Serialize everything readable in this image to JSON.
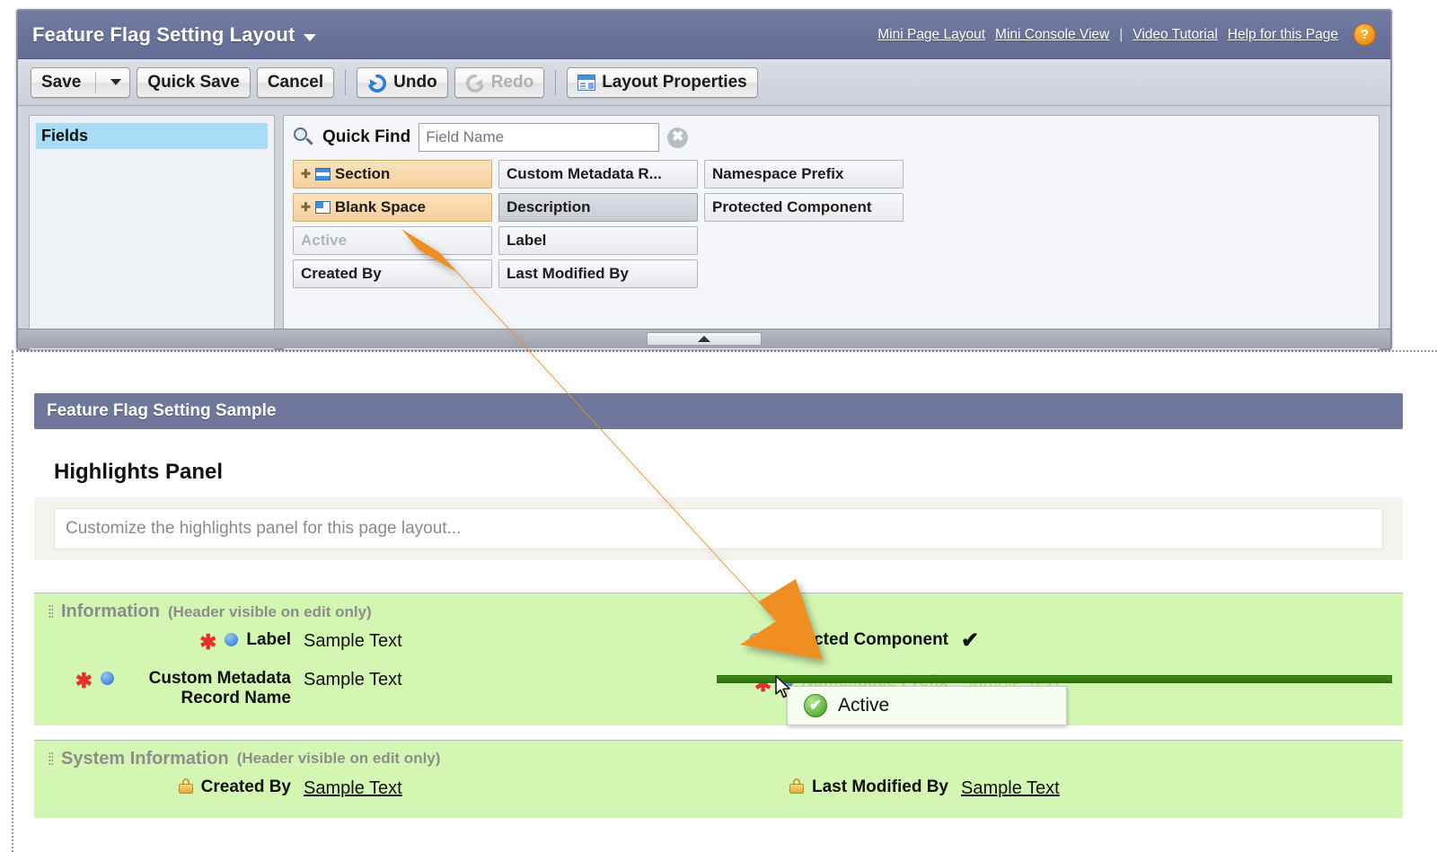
{
  "editor": {
    "title": "Feature Flag Setting Layout",
    "title_caret_icon": "chevron-down-icon",
    "links": [
      {
        "label": "Mini Page Layout"
      },
      {
        "label": "Mini Console View"
      },
      {
        "separator": "|"
      },
      {
        "label": "Video Tutorial"
      },
      {
        "label": "Help for this Page"
      }
    ],
    "help_badge": "?",
    "toolbar": {
      "save_label": "Save",
      "save_caret_icon": "chevron-down-icon",
      "quick_save_label": "Quick Save",
      "cancel_label": "Cancel",
      "undo_label": "Undo",
      "undo_icon": "undo-arrow-icon",
      "redo_label": "Redo",
      "redo_icon": "redo-arrow-icon",
      "redo_disabled": true,
      "layout_properties_label": "Layout Properties",
      "layout_properties_icon": "layout-grid-icon"
    },
    "sidebar": {
      "header": "Fields"
    },
    "quick_find": {
      "icon": "search-icon",
      "label": "Quick Find",
      "value": "",
      "placeholder": "Field Name",
      "clear_icon": "clear-x-icon"
    },
    "palette": {
      "columns": [
        [
          {
            "label": "Section",
            "icon": "section-icon",
            "style": "special"
          },
          {
            "label": "Blank Space",
            "icon": "blank-space-icon",
            "style": "special"
          },
          {
            "label": "Active",
            "style": "ghosted"
          },
          {
            "label": "Created By",
            "style": "normal"
          }
        ],
        [
          {
            "label": "Custom Metadata R...",
            "style": "normal"
          },
          {
            "label": "Description",
            "style": "selected"
          },
          {
            "label": "Label",
            "style": "normal"
          },
          {
            "label": "Last Modified By",
            "style": "normal"
          }
        ],
        [
          {
            "label": "Namespace Prefix",
            "style": "normal"
          },
          {
            "label": "Protected Component",
            "style": "normal"
          }
        ]
      ]
    },
    "splitter_icon": "collapse-up-triangle-icon"
  },
  "preview": {
    "record_title": "Feature Flag Setting Sample",
    "highlights_heading": "Highlights Panel",
    "highlights_placeholder": "Customize the highlights panel for this page layout...",
    "sections": [
      {
        "name": "Information",
        "note": "(Header visible on edit only)",
        "grip_icon": "drag-grip-icon",
        "left_fields": [
          {
            "label": "Label",
            "value": "Sample Text",
            "required": true,
            "required_icon": "required-asterisk-icon",
            "dot_icon": "blue-dot-icon",
            "link": false
          },
          {
            "label": "Custom Metadata Record Name",
            "value": "Sample Text",
            "required": true,
            "required_icon": "required-asterisk-icon",
            "dot_icon": "blue-dot-icon",
            "link": false
          }
        ],
        "right_fields": [
          {
            "label": "Protected Component",
            "value": "✔",
            "required": false,
            "dot_icon": "blue-dot-icon",
            "is_check": true
          },
          {
            "label": "Namespace Prefix",
            "value": "Sample Text",
            "required": true,
            "required_icon": "required-asterisk-icon",
            "dot_icon": "blue-dot-icon",
            "faded": true
          }
        ]
      },
      {
        "name": "System Information",
        "note": "(Header visible on edit only)",
        "grip_icon": "drag-grip-icon",
        "left_fields": [
          {
            "label": "Created By",
            "value": "Sample Text",
            "lock_icon": "lock-icon",
            "link": true
          }
        ],
        "right_fields": [
          {
            "label": "Last Modified By",
            "value": "Sample Text",
            "lock_icon": "lock-icon",
            "link": true
          }
        ]
      }
    ],
    "drag_ghost": {
      "label": "Active",
      "icon": "green-check-circle-icon"
    },
    "drop_indicator_color": "#2d6b0c",
    "cursor_icon": "mouse-pointer-icon"
  },
  "annotation": {
    "arrow_icon": "orange-callout-arrow-icon",
    "arrow_color": "#ef8f20"
  }
}
